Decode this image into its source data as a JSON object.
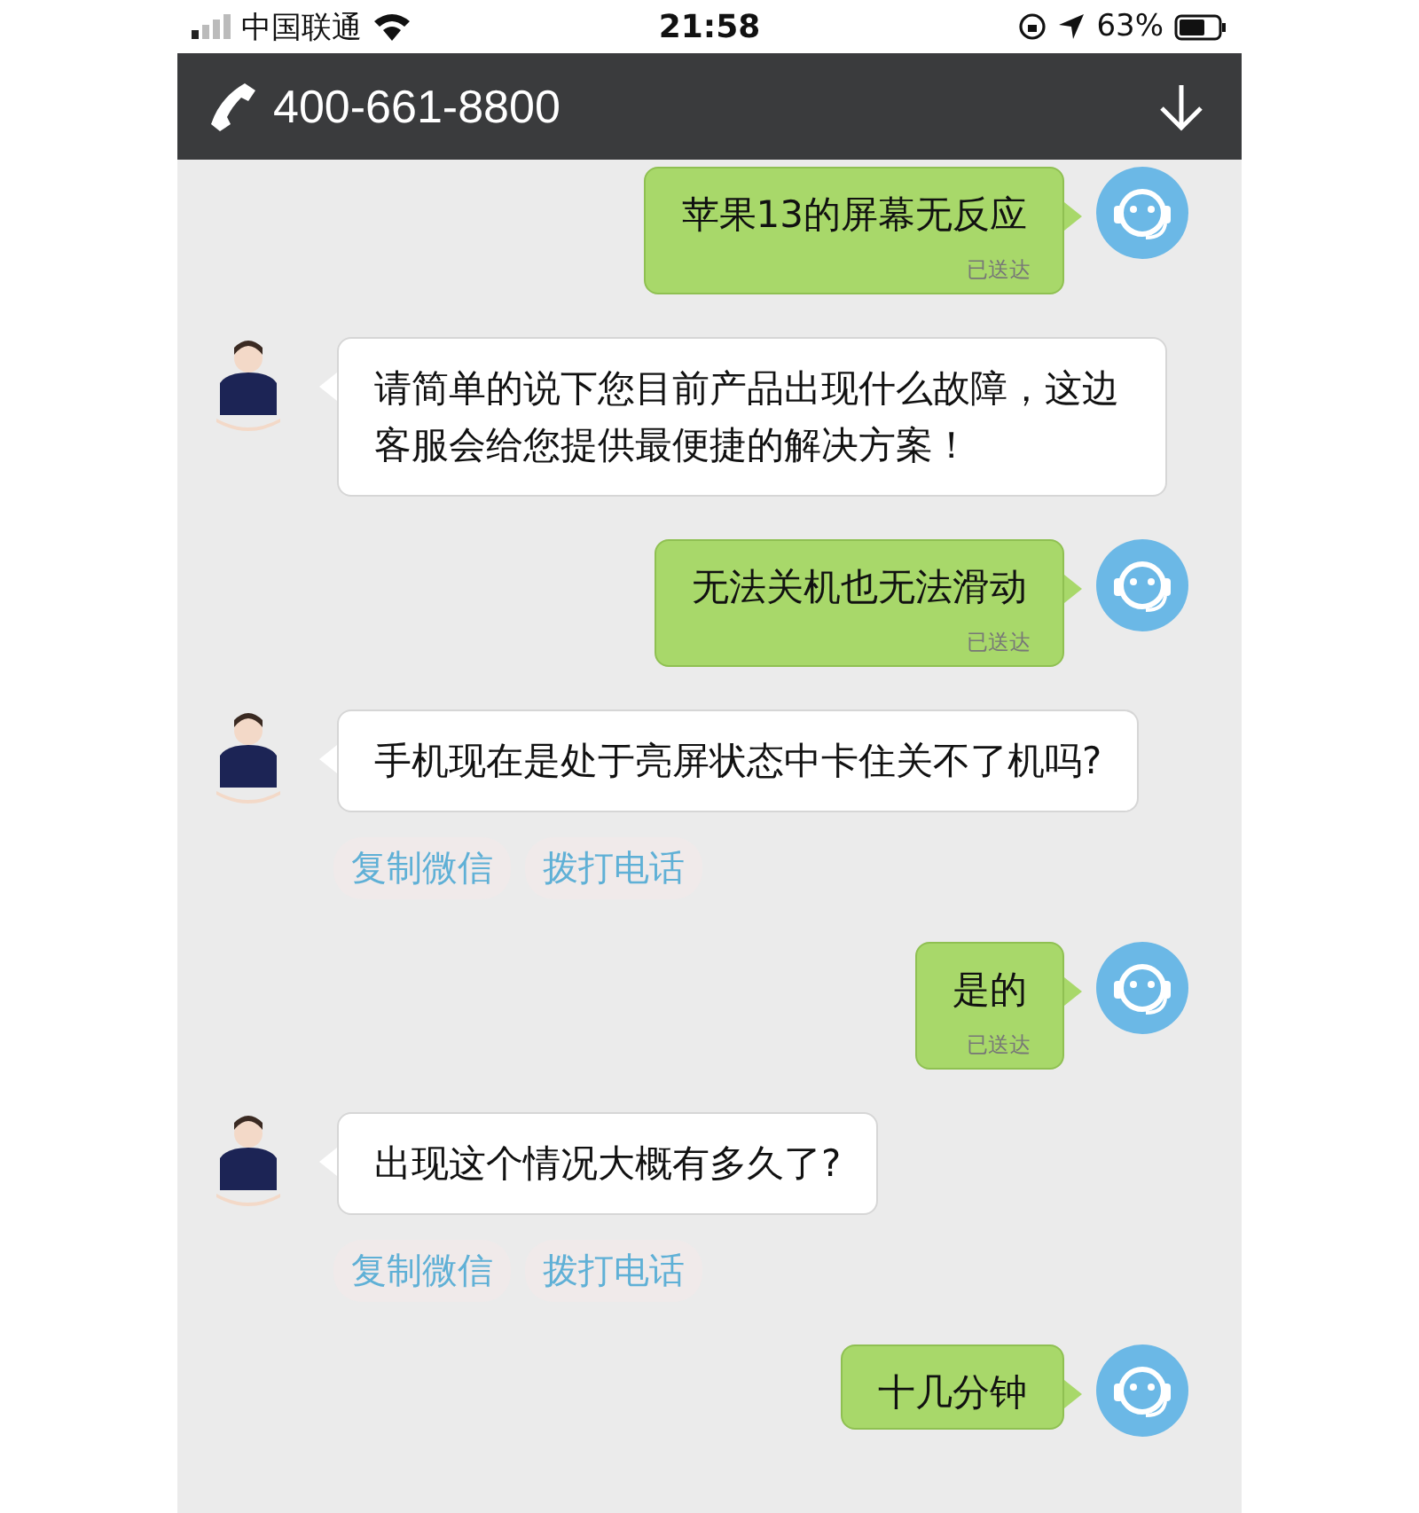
{
  "status_bar": {
    "carrier": "中国联通",
    "time": "21:58",
    "battery": "63%"
  },
  "header": {
    "phone": "400-661-8800"
  },
  "messages": [
    {
      "kind": "sent",
      "text": "苹果13的屏幕无反应",
      "status": "已送达"
    },
    {
      "kind": "received",
      "text": "请简单的说下您目前产品出现什么故障，这边客服会给您提供最便捷的解决方案！"
    },
    {
      "kind": "sent",
      "text": "无法关机也无法滑动",
      "status": "已送达"
    },
    {
      "kind": "received",
      "text": "手机现在是处于亮屏状态中卡住关不了机吗?",
      "actions": [
        "复制微信",
        "拨打电话"
      ]
    },
    {
      "kind": "sent",
      "text": "是的",
      "status": "已送达"
    },
    {
      "kind": "received",
      "text": "出现这个情况大概有多久了?",
      "actions": [
        "复制微信",
        "拨打电话"
      ]
    },
    {
      "kind": "sent",
      "text": "十几分钟"
    }
  ]
}
